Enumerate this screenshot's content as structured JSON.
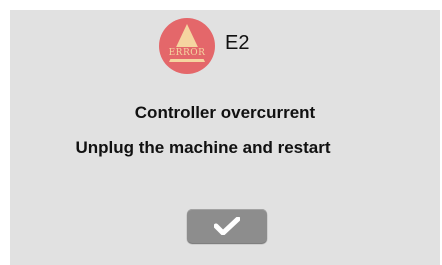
{
  "dialog": {
    "icon": "error-warning-icon",
    "icon_text": "ERROR",
    "error_code": "E2",
    "message_line1": "Controller overcurrent",
    "message_line2": "Unplug the machine and restart",
    "confirm_icon": "checkmark-icon"
  },
  "colors": {
    "panel_background": "#e1e1e1",
    "icon_circle": "#e4676a",
    "icon_symbol": "#f5d5a0",
    "button": "#8d8d8d"
  }
}
